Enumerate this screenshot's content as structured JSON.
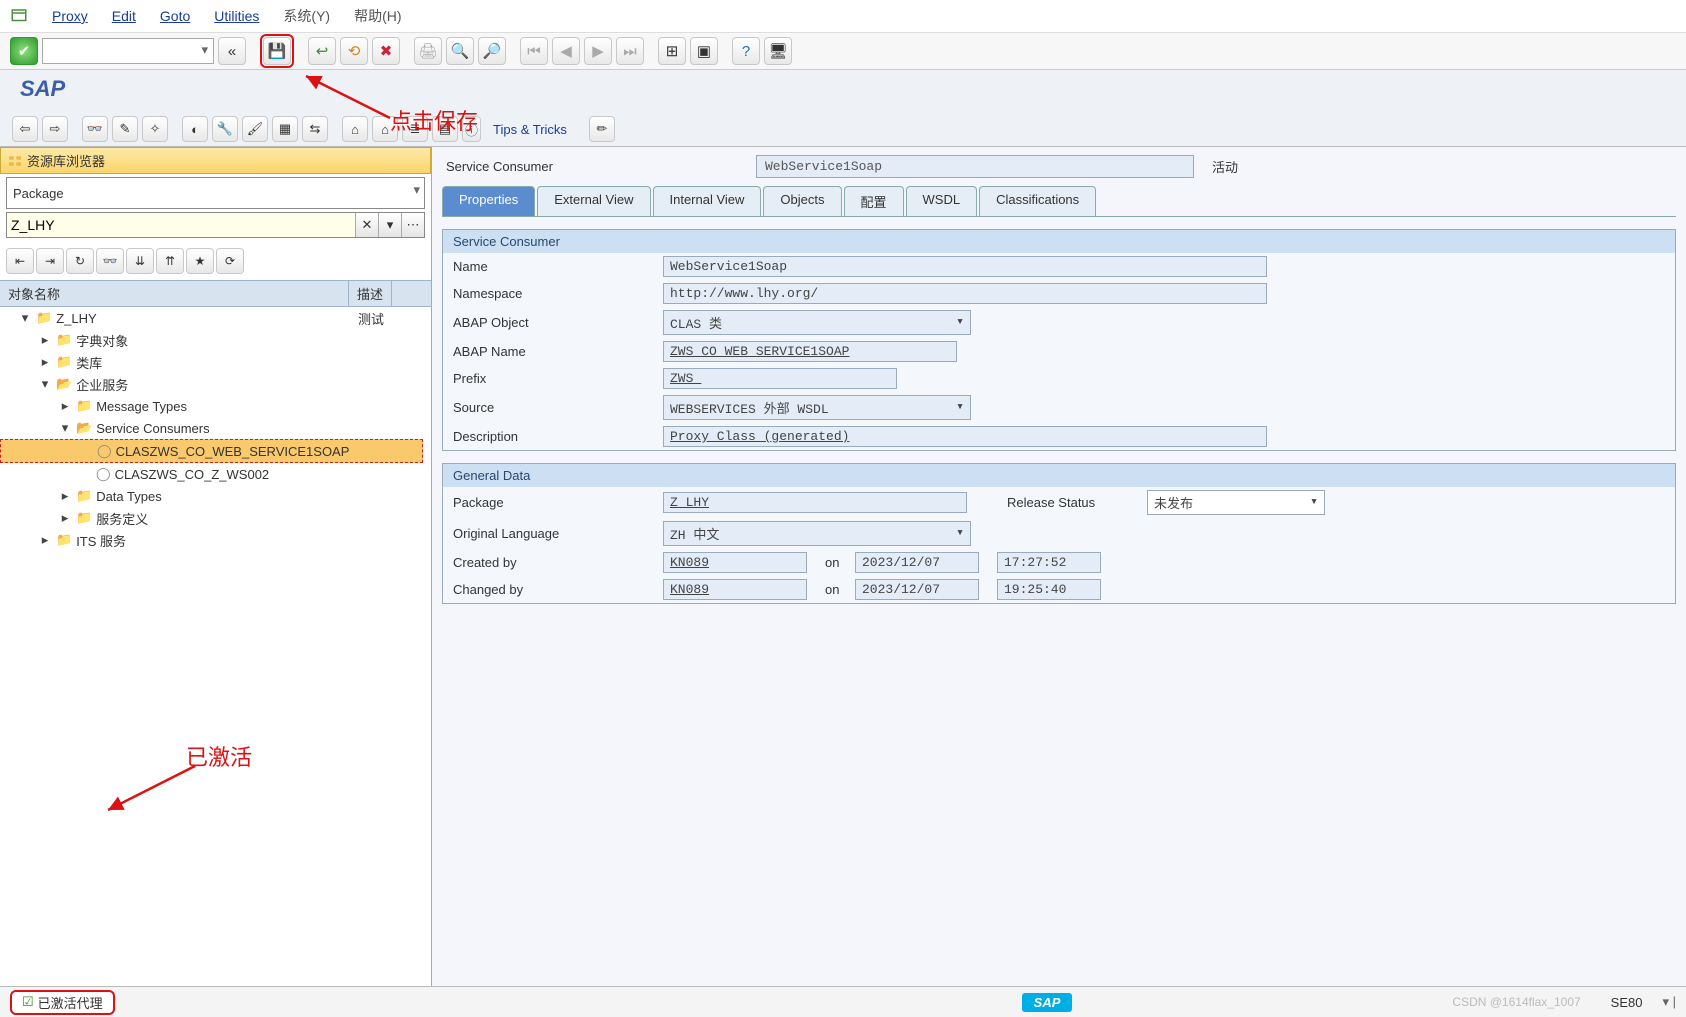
{
  "menu": {
    "items": [
      "Proxy",
      "Edit",
      "Goto",
      "Utilities"
    ],
    "cn": [
      "系统(Y)",
      "帮助(H)"
    ]
  },
  "title": "SAP",
  "tips_label": "Tips & Tricks",
  "annotations": {
    "save": "点击保存",
    "activated": "已激活"
  },
  "left": {
    "panel_title": "资源库浏览器",
    "combo": "Package",
    "input": "Z_LHY",
    "cols": [
      "对象名称",
      "描述"
    ],
    "tree": {
      "root": {
        "label": "Z_LHY",
        "desc": "测试"
      },
      "n1": "字典对象",
      "n2": "类库",
      "n3": "企业服务",
      "n3a": "Message Types",
      "n3b": "Service Consumers",
      "n3b1": "CLASZWS_CO_WEB_SERVICE1SOAP",
      "n3b2": "CLASZWS_CO_Z_WS002",
      "n3c": "Data Types",
      "n3d": "服务定义",
      "n4": "ITS 服务"
    }
  },
  "right": {
    "header": {
      "label": "Service Consumer",
      "value": "WebService1Soap",
      "status": "活动"
    },
    "tabs": [
      "Properties",
      "External View",
      "Internal View",
      "Objects",
      "配置",
      "WSDL",
      "Classifications"
    ],
    "grp1": {
      "title": "Service Consumer",
      "name_l": "Name",
      "name_v": "WebService1Soap",
      "ns_l": "Namespace",
      "ns_v": "http://www.lhy.org/",
      "abapobj_l": "ABAP Object",
      "abapobj_v": "CLAS 类",
      "abapname_l": "ABAP Name",
      "abapname_v": "ZWS_CO_WEB_SERVICE1SOAP",
      "prefix_l": "Prefix",
      "prefix_v": "ZWS_",
      "source_l": "Source",
      "source_v": "WEBSERVICES 外部 WSDL",
      "desc_l": "Description",
      "desc_v": "Proxy Class (generated)"
    },
    "grp2": {
      "title": "General Data",
      "pkg_l": "Package",
      "pkg_v": "Z_LHY",
      "rel_l": "Release Status",
      "rel_v": "未发布",
      "olang_l": "Original Language",
      "olang_v": "ZH 中文",
      "crby_l": "Created by",
      "crby_v": "KN089",
      "on": "on",
      "crby_d": "2023/12/07",
      "crby_t": "17:27:52",
      "chby_l": "Changed by",
      "chby_v": "KN089",
      "chby_d": "2023/12/07",
      "chby_t": "19:25:40"
    }
  },
  "status": {
    "msg": "已激活代理",
    "tcode": "SE80",
    "watermark": "CSDN @1614flax_1007"
  }
}
